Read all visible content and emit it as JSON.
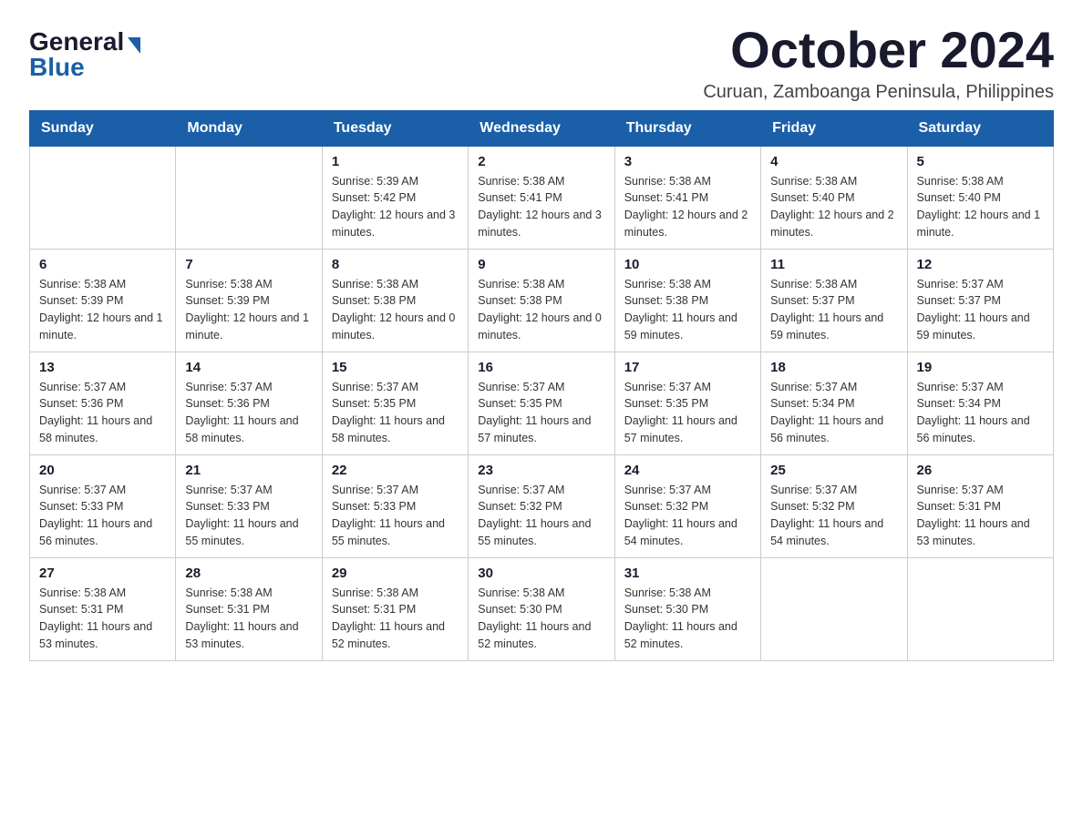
{
  "logo": {
    "general": "General",
    "blue": "Blue"
  },
  "title": "October 2024",
  "location": "Curuan, Zamboanga Peninsula, Philippines",
  "headers": [
    "Sunday",
    "Monday",
    "Tuesday",
    "Wednesday",
    "Thursday",
    "Friday",
    "Saturday"
  ],
  "weeks": [
    [
      {
        "day": "",
        "sunrise": "",
        "sunset": "",
        "daylight": ""
      },
      {
        "day": "",
        "sunrise": "",
        "sunset": "",
        "daylight": ""
      },
      {
        "day": "1",
        "sunrise": "Sunrise: 5:39 AM",
        "sunset": "Sunset: 5:42 PM",
        "daylight": "Daylight: 12 hours and 3 minutes."
      },
      {
        "day": "2",
        "sunrise": "Sunrise: 5:38 AM",
        "sunset": "Sunset: 5:41 PM",
        "daylight": "Daylight: 12 hours and 3 minutes."
      },
      {
        "day": "3",
        "sunrise": "Sunrise: 5:38 AM",
        "sunset": "Sunset: 5:41 PM",
        "daylight": "Daylight: 12 hours and 2 minutes."
      },
      {
        "day": "4",
        "sunrise": "Sunrise: 5:38 AM",
        "sunset": "Sunset: 5:40 PM",
        "daylight": "Daylight: 12 hours and 2 minutes."
      },
      {
        "day": "5",
        "sunrise": "Sunrise: 5:38 AM",
        "sunset": "Sunset: 5:40 PM",
        "daylight": "Daylight: 12 hours and 1 minute."
      }
    ],
    [
      {
        "day": "6",
        "sunrise": "Sunrise: 5:38 AM",
        "sunset": "Sunset: 5:39 PM",
        "daylight": "Daylight: 12 hours and 1 minute."
      },
      {
        "day": "7",
        "sunrise": "Sunrise: 5:38 AM",
        "sunset": "Sunset: 5:39 PM",
        "daylight": "Daylight: 12 hours and 1 minute."
      },
      {
        "day": "8",
        "sunrise": "Sunrise: 5:38 AM",
        "sunset": "Sunset: 5:38 PM",
        "daylight": "Daylight: 12 hours and 0 minutes."
      },
      {
        "day": "9",
        "sunrise": "Sunrise: 5:38 AM",
        "sunset": "Sunset: 5:38 PM",
        "daylight": "Daylight: 12 hours and 0 minutes."
      },
      {
        "day": "10",
        "sunrise": "Sunrise: 5:38 AM",
        "sunset": "Sunset: 5:38 PM",
        "daylight": "Daylight: 11 hours and 59 minutes."
      },
      {
        "day": "11",
        "sunrise": "Sunrise: 5:38 AM",
        "sunset": "Sunset: 5:37 PM",
        "daylight": "Daylight: 11 hours and 59 minutes."
      },
      {
        "day": "12",
        "sunrise": "Sunrise: 5:37 AM",
        "sunset": "Sunset: 5:37 PM",
        "daylight": "Daylight: 11 hours and 59 minutes."
      }
    ],
    [
      {
        "day": "13",
        "sunrise": "Sunrise: 5:37 AM",
        "sunset": "Sunset: 5:36 PM",
        "daylight": "Daylight: 11 hours and 58 minutes."
      },
      {
        "day": "14",
        "sunrise": "Sunrise: 5:37 AM",
        "sunset": "Sunset: 5:36 PM",
        "daylight": "Daylight: 11 hours and 58 minutes."
      },
      {
        "day": "15",
        "sunrise": "Sunrise: 5:37 AM",
        "sunset": "Sunset: 5:35 PM",
        "daylight": "Daylight: 11 hours and 58 minutes."
      },
      {
        "day": "16",
        "sunrise": "Sunrise: 5:37 AM",
        "sunset": "Sunset: 5:35 PM",
        "daylight": "Daylight: 11 hours and 57 minutes."
      },
      {
        "day": "17",
        "sunrise": "Sunrise: 5:37 AM",
        "sunset": "Sunset: 5:35 PM",
        "daylight": "Daylight: 11 hours and 57 minutes."
      },
      {
        "day": "18",
        "sunrise": "Sunrise: 5:37 AM",
        "sunset": "Sunset: 5:34 PM",
        "daylight": "Daylight: 11 hours and 56 minutes."
      },
      {
        "day": "19",
        "sunrise": "Sunrise: 5:37 AM",
        "sunset": "Sunset: 5:34 PM",
        "daylight": "Daylight: 11 hours and 56 minutes."
      }
    ],
    [
      {
        "day": "20",
        "sunrise": "Sunrise: 5:37 AM",
        "sunset": "Sunset: 5:33 PM",
        "daylight": "Daylight: 11 hours and 56 minutes."
      },
      {
        "day": "21",
        "sunrise": "Sunrise: 5:37 AM",
        "sunset": "Sunset: 5:33 PM",
        "daylight": "Daylight: 11 hours and 55 minutes."
      },
      {
        "day": "22",
        "sunrise": "Sunrise: 5:37 AM",
        "sunset": "Sunset: 5:33 PM",
        "daylight": "Daylight: 11 hours and 55 minutes."
      },
      {
        "day": "23",
        "sunrise": "Sunrise: 5:37 AM",
        "sunset": "Sunset: 5:32 PM",
        "daylight": "Daylight: 11 hours and 55 minutes."
      },
      {
        "day": "24",
        "sunrise": "Sunrise: 5:37 AM",
        "sunset": "Sunset: 5:32 PM",
        "daylight": "Daylight: 11 hours and 54 minutes."
      },
      {
        "day": "25",
        "sunrise": "Sunrise: 5:37 AM",
        "sunset": "Sunset: 5:32 PM",
        "daylight": "Daylight: 11 hours and 54 minutes."
      },
      {
        "day": "26",
        "sunrise": "Sunrise: 5:37 AM",
        "sunset": "Sunset: 5:31 PM",
        "daylight": "Daylight: 11 hours and 53 minutes."
      }
    ],
    [
      {
        "day": "27",
        "sunrise": "Sunrise: 5:38 AM",
        "sunset": "Sunset: 5:31 PM",
        "daylight": "Daylight: 11 hours and 53 minutes."
      },
      {
        "day": "28",
        "sunrise": "Sunrise: 5:38 AM",
        "sunset": "Sunset: 5:31 PM",
        "daylight": "Daylight: 11 hours and 53 minutes."
      },
      {
        "day": "29",
        "sunrise": "Sunrise: 5:38 AM",
        "sunset": "Sunset: 5:31 PM",
        "daylight": "Daylight: 11 hours and 52 minutes."
      },
      {
        "day": "30",
        "sunrise": "Sunrise: 5:38 AM",
        "sunset": "Sunset: 5:30 PM",
        "daylight": "Daylight: 11 hours and 52 minutes."
      },
      {
        "day": "31",
        "sunrise": "Sunrise: 5:38 AM",
        "sunset": "Sunset: 5:30 PM",
        "daylight": "Daylight: 11 hours and 52 minutes."
      },
      {
        "day": "",
        "sunrise": "",
        "sunset": "",
        "daylight": ""
      },
      {
        "day": "",
        "sunrise": "",
        "sunset": "",
        "daylight": ""
      }
    ]
  ]
}
